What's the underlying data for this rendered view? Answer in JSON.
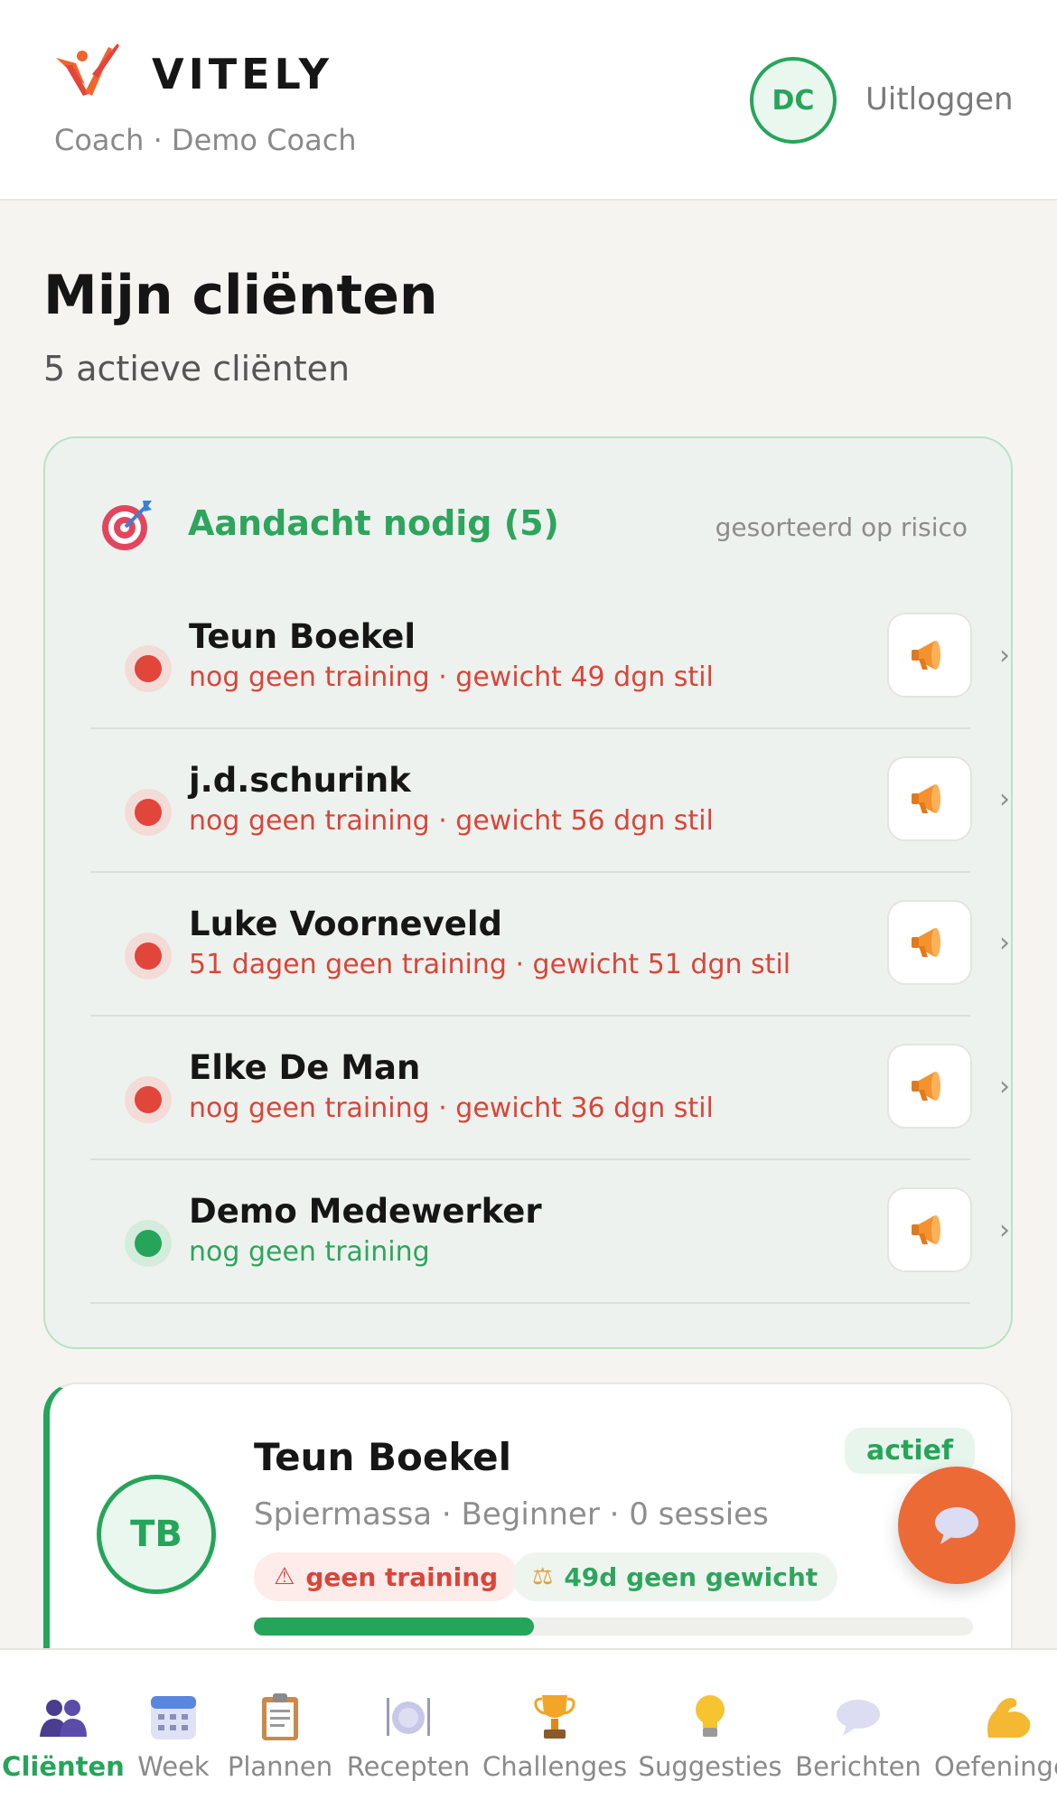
{
  "header": {
    "brand": "VITELY",
    "subtitle": "Coach · Demo Coach",
    "avatar_initials": "DC",
    "logout_label": "Uitloggen"
  },
  "page": {
    "title": "Mijn cliënten",
    "subtitle": "5 actieve cliënten"
  },
  "attention": {
    "title": "Aandacht nodig (5)",
    "sort_label": "gesorteerd op risico",
    "icon": "target-icon",
    "rows": [
      {
        "name": "Teun Boekel",
        "meta": "nog geen training · gewicht 49 dgn stil",
        "risk": "red"
      },
      {
        "name": "j.d.schurink",
        "meta": "nog geen training · gewicht 56 dgn stil",
        "risk": "red"
      },
      {
        "name": "Luke Voorneveld",
        "meta": "51 dagen geen training · gewicht 51 dgn stil",
        "risk": "red"
      },
      {
        "name": "Elke De Man",
        "meta": "nog geen training · gewicht 36 dgn stil",
        "risk": "red"
      },
      {
        "name": "Demo Medewerker",
        "meta": "nog geen training",
        "risk": "green"
      }
    ]
  },
  "client_card": {
    "initials": "TB",
    "name": "Teun Boekel",
    "details": "Spiermassa · Beginner · 0 sessies",
    "status": "actief",
    "tag_warning": "geen training",
    "tag_weight": "49d geen gewicht",
    "progress": 0.39
  },
  "nav": {
    "items": [
      {
        "label": "Cliënten",
        "icon": "clients-icon",
        "active": true
      },
      {
        "label": "Week",
        "icon": "calendar-icon",
        "active": false
      },
      {
        "label": "Plannen",
        "icon": "clipboard-icon",
        "active": false
      },
      {
        "label": "Recepten",
        "icon": "plate-icon",
        "active": false
      },
      {
        "label": "Challenges",
        "icon": "trophy-icon",
        "active": false
      },
      {
        "label": "Suggesties",
        "icon": "lightbulb-icon",
        "active": false
      },
      {
        "label": "Berichten",
        "icon": "speech-bubble-icon",
        "active": false
      },
      {
        "label": "Oefeningen",
        "icon": "flexed-biceps-icon",
        "active": false
      }
    ]
  },
  "colors": {
    "accent_green": "#25a55a",
    "risk_red": "#e2453a",
    "fab_orange": "#ec6a36"
  }
}
